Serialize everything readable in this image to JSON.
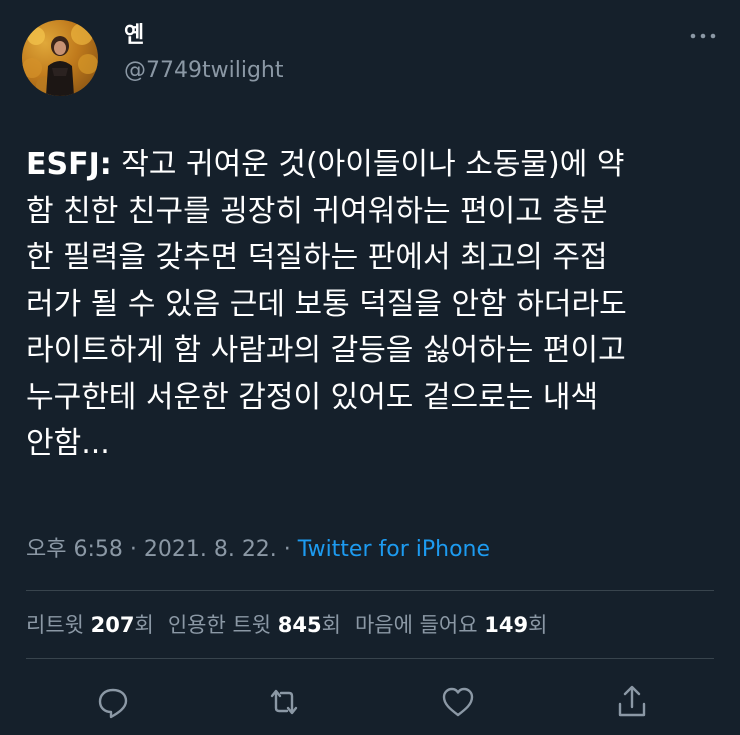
{
  "author": {
    "display_name": "옌",
    "handle": "@7749twilight",
    "avatar_icon": "profile-photo"
  },
  "menu_icon": "more-horizontal-icon",
  "tweet": {
    "lead": "ESFJ:",
    "lines": [
      " 작고 귀여운 것(아이들이나 소동물)에 약",
      "함 친한 친구를 굉장히 귀여워하는 편이고 충분",
      "한 필력을 갖추면 덕질하는 판에서 최고의 주접",
      "러가 될 수 있음 근데 보통 덕질을 안함 하더라도",
      "라이트하게 함 사람과의 갈등을 싫어하는 편이고",
      "누구한테 서운한 감정이 있어도 겉으로는 내색",
      "안함..."
    ]
  },
  "meta": {
    "time": "오후 6:58 · 2021. 8. 22. · ",
    "source": "Twitter for iPhone"
  },
  "stats": {
    "retweets_label": "리트윗 ",
    "retweets_count": "207",
    "retweets_suffix": "회",
    "quotes_label": "인용한 트윗 ",
    "quotes_count": "845",
    "quotes_suffix": "회",
    "likes_label": "마음에 들어요 ",
    "likes_count": "149",
    "likes_suffix": "회"
  },
  "actions": [
    "reply-icon",
    "retweet-icon",
    "like-icon",
    "share-icon"
  ],
  "colors": {
    "background": "#15202b",
    "text": "#ffffff",
    "secondary": "#8b98a5",
    "accent": "#1d9bf0",
    "divider": "#38444d"
  }
}
